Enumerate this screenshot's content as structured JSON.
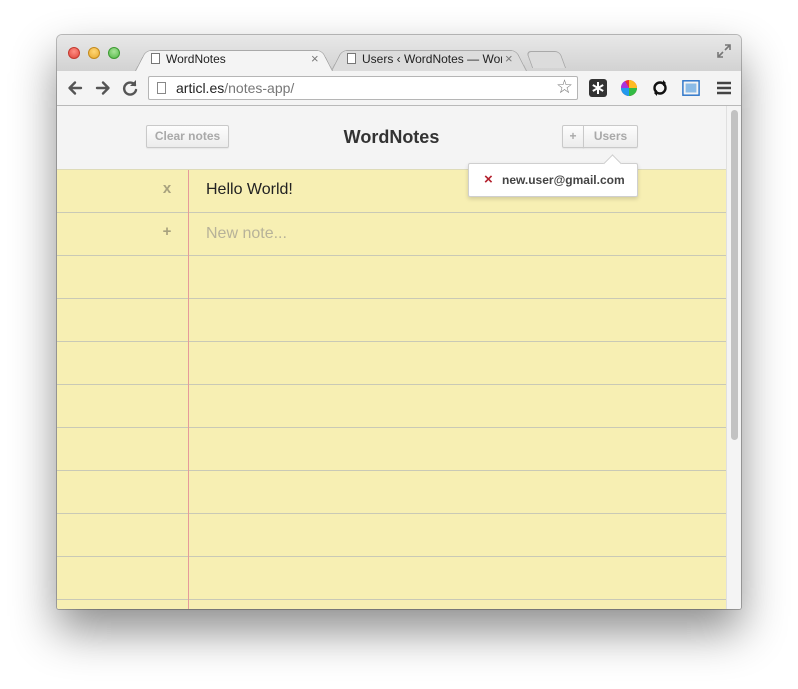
{
  "browser": {
    "tabs": [
      {
        "title": "WordNotes",
        "close": "×",
        "active": true
      },
      {
        "title": "Users ‹ WordNotes — Word",
        "close": "×",
        "active": false
      }
    ],
    "address": {
      "host": "articl.es",
      "path": "/notes-app/"
    },
    "icons": {
      "back": "back-arrow-icon",
      "forward": "forward-arrow-icon",
      "reload": "reload-icon",
      "bookmark": "star-icon",
      "menu": "hamburger-menu-icon"
    }
  },
  "app": {
    "title": "WordNotes",
    "clear_label": "Clear notes",
    "add_user_label": "+",
    "users_label": "Users",
    "users_dropdown": {
      "remove_icon": "×",
      "email": "new.user@gmail.com"
    }
  },
  "notes": [
    {
      "action": "x",
      "text": "Hello World!"
    }
  ],
  "new_note": {
    "action": "+",
    "placeholder": "New note..."
  },
  "colors": {
    "paper": "#f7efb3",
    "margin_line": "#e69a9a",
    "rule_line": "#c9c9b6",
    "remove_user": "#b3202d"
  }
}
